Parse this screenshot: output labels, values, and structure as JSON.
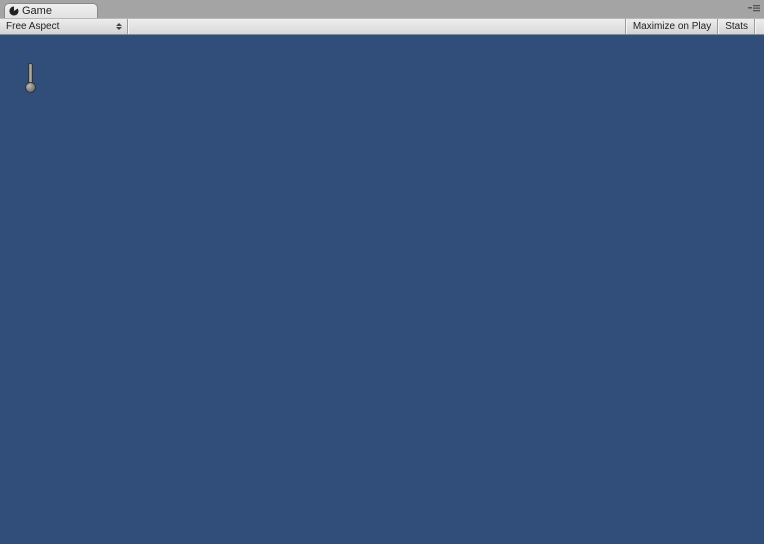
{
  "tab": {
    "label": "Game"
  },
  "toolbar": {
    "aspect_label": "Free Aspect",
    "maximize_label": "Maximize on Play",
    "stats_label": "Stats"
  }
}
